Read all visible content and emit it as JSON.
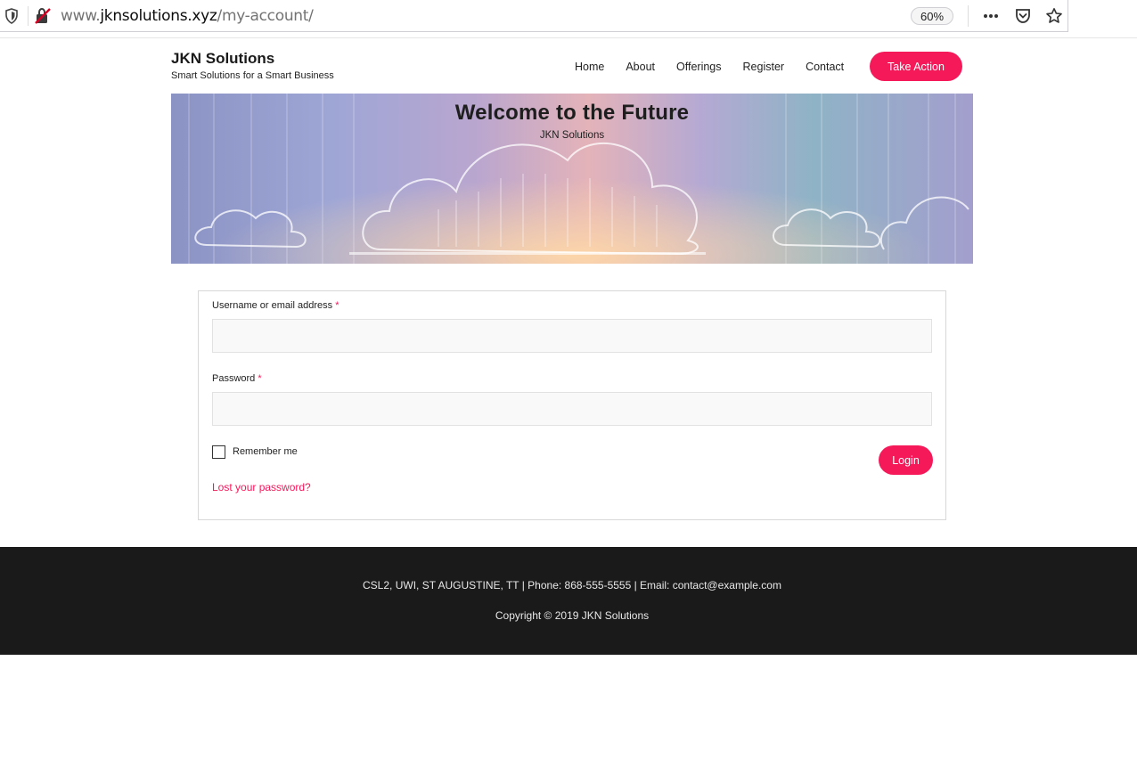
{
  "browser": {
    "url_prefix": "www.",
    "url_host": "jknsolutions.xyz",
    "url_path": "/my-account/",
    "zoom": "60%",
    "icons": [
      "tracking-protection-shield-icon",
      "insecure-connection-icon",
      "page-actions-more-icon",
      "pocket-icon",
      "bookmark-star-icon"
    ]
  },
  "header": {
    "site_title": "JKN Solutions",
    "tagline": "Smart Solutions for a Smart Business",
    "nav": [
      "Home",
      "About",
      "Offerings",
      "Register",
      "Contact"
    ],
    "cta_label": "Take Action"
  },
  "hero": {
    "title": "Welcome to the Future",
    "subtitle": "JKN Solutions"
  },
  "login": {
    "username_label": "Username or email address",
    "password_label": "Password",
    "required_mark": "*",
    "username_value": "",
    "password_value": "",
    "remember_label": "Remember me",
    "remember_checked": false,
    "login_label": "Login",
    "lost_password": "Lost your password?"
  },
  "footer": {
    "contact_line": "CSL2, UWI, ST AUGUSTINE, TT | Phone: 868-555-5555 | Email: contact@example.com",
    "copyright": "Copyright © 2019 JKN Solutions"
  },
  "colors": {
    "accent": "#f5195a",
    "footer_bg": "#1a1a1a"
  }
}
